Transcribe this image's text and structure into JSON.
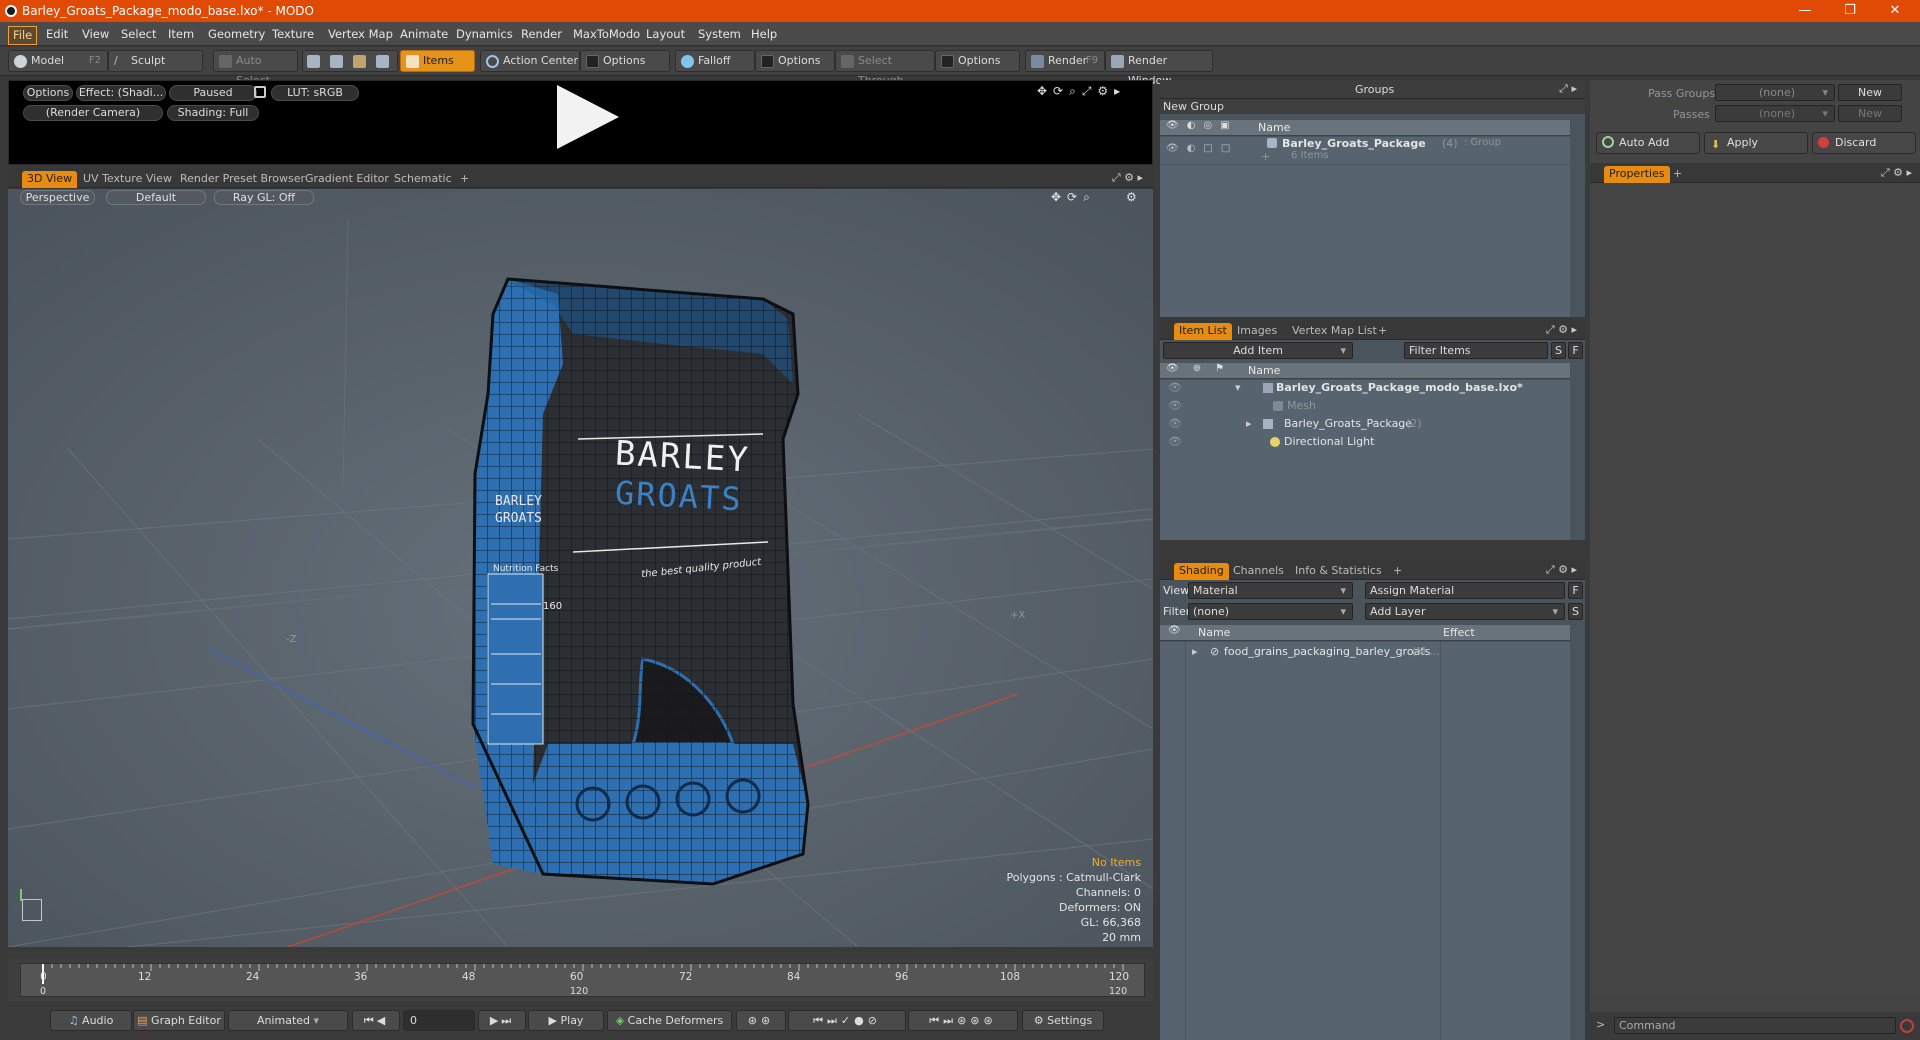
{
  "window": {
    "title": "Barley_Groats_Package_modo_base.lxo* - MODO",
    "minimize": "—",
    "maximize": "❐",
    "close": "✕"
  },
  "menu": [
    "File",
    "Edit",
    "View",
    "Select",
    "Item",
    "Geometry",
    "Texture",
    "Vertex Map",
    "Animate",
    "Dynamics",
    "Render",
    "MaxToModo",
    "Layout",
    "System",
    "Help"
  ],
  "toolbar": {
    "model": "Model",
    "model_key": "F2",
    "sculpt": "Sculpt",
    "auto_select": "Auto Select",
    "items": "Items",
    "action_center": "Action Center",
    "options1": "Options",
    "falloff": "Falloff",
    "options2": "Options",
    "select_through": "Select Through",
    "options3": "Options",
    "render": "Render",
    "render_key": "F9",
    "render_window": "Render Window"
  },
  "preview": {
    "options": "Options",
    "effect": "Effect: (Shadi...",
    "paused": "Paused",
    "lut": "LUT: sRGB",
    "camera": "(Render Camera)",
    "shading": "Shading: Full"
  },
  "view_tabs": [
    "3D View",
    "UV Texture View",
    "Render Preset Browser",
    "Gradient Editor",
    "Schematic",
    "+"
  ],
  "viewport": {
    "perspective": "Perspective",
    "default": "Default",
    "raygl": "Ray GL: Off",
    "axis_z": "-Z",
    "axis_x": "+X",
    "info": {
      "no_items": "No Items",
      "polygons": "Polygons : Catmull-Clark",
      "channels": "Channels: 0",
      "deformers": "Deformers: ON",
      "gl": "GL: 66,368",
      "scale": "20 mm"
    }
  },
  "product": {
    "brand1": "BARLEY",
    "brand2": "GROATS",
    "tagline": "the best quality product",
    "side1": "BARLEY",
    "side2": "GROATS",
    "nutrition": "Nutrition Facts",
    "calories": "160"
  },
  "timeline": {
    "ticks": [
      "0",
      "12",
      "24",
      "36",
      "48",
      "60",
      "72",
      "84",
      "96",
      "108",
      "120"
    ],
    "lower_ticks": [
      "0",
      "120",
      "120"
    ]
  },
  "bottom": {
    "audio": "Audio",
    "graph_editor": "Graph Editor",
    "animated": "Animated",
    "frame": "0",
    "play": "Play",
    "cache_deformers": "Cache Deformers",
    "settings": "Settings"
  },
  "groups": {
    "title": "Groups",
    "new_group": "New Group",
    "col_name": "Name",
    "item_name": "Barley_Groats_Package",
    "item_count": "(4)",
    "item_type": ": Group",
    "item_sub": "6 Items"
  },
  "itemlist": {
    "tabs": [
      "Item List",
      "Images",
      "Vertex Map List",
      "+"
    ],
    "add_item": "Add Item",
    "filter": "Filter Items",
    "s": "S",
    "f": "F",
    "col_name": "Name",
    "rows": [
      {
        "label": "Barley_Groats_Package_modo_base.lxo*",
        "extra": ""
      },
      {
        "label": "Mesh",
        "extra": ""
      },
      {
        "label": "Barley_Groats_Package",
        "extra": "(2)"
      },
      {
        "label": "Directional Light",
        "extra": ""
      }
    ]
  },
  "shading": {
    "tabs": [
      "Shading",
      "Channels",
      "Info & Statistics",
      "+"
    ],
    "view_label": "View",
    "view_val": "Material",
    "assign": "Assign Material",
    "f": "F",
    "filter_label": "Filter",
    "filter_val": "(none)",
    "add_layer": "Add Layer",
    "s": "S",
    "col_name": "Name",
    "col_effect": "Effect",
    "row": "food_grains_packaging_barley_groats",
    "row_extra": "(M ..."
  },
  "passes": {
    "pass_groups": "Pass Groups",
    "pass_val": "(none)",
    "new1": "New",
    "passes": "Passes",
    "passes_val": "(none)",
    "new2": "New"
  },
  "props": {
    "auto_add": "Auto Add",
    "apply": "Apply",
    "discard": "Discard",
    "tab": "Properties",
    "plus": "+",
    "command": "Command"
  },
  "colors": {
    "accent": "#e78c10",
    "title": "#e04a05",
    "pack_blue": "#2d6fb0"
  }
}
